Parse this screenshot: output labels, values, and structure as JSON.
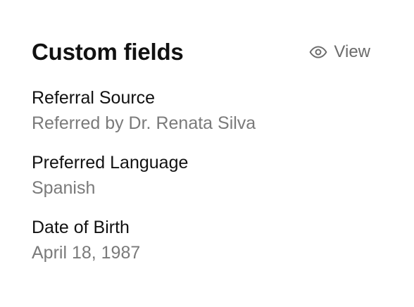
{
  "section": {
    "title": "Custom fields",
    "view_label": "View",
    "view_icon": "eye-icon"
  },
  "fields": [
    {
      "label": "Referral Source",
      "value": "Referred by Dr. Renata Silva"
    },
    {
      "label": "Preferred Language",
      "value": "Spanish"
    },
    {
      "label": "Date of Birth",
      "value": "April 18, 1987"
    }
  ],
  "colors": {
    "title": "#111111",
    "label": "#111111",
    "value": "#7a7a7a",
    "link": "#6b6b6b"
  }
}
